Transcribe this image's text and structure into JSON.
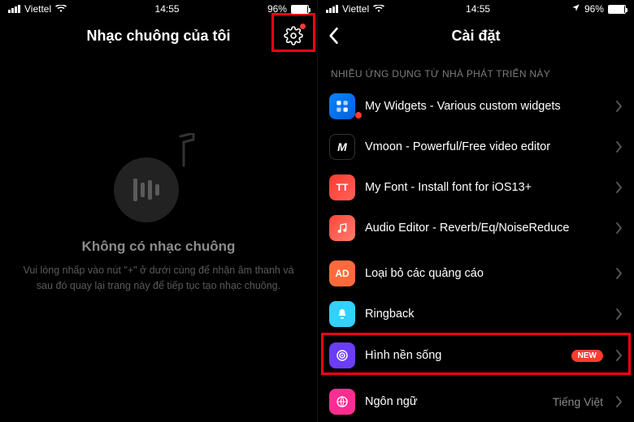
{
  "status": {
    "carrier": "Viettel",
    "time": "14:55",
    "battery_pct": "96%",
    "battery_level_pct": 96,
    "right_has_location": true
  },
  "left": {
    "title": "Nhạc chuông của tôi",
    "empty_title": "Không có nhạc chuông",
    "empty_sub": "Vui lòng nhấp vào nút \"+\" ở dưới cùng để nhận âm thanh và sau đó quay lại trang này để tiếp tục tạo nhạc chuông."
  },
  "right": {
    "title": "Cài đặt",
    "section_header": "NHIỀU ỨNG DỤNG TỪ NHÀ PHÁT TRIỂN NÀY",
    "rows_group1": [
      {
        "label": "My Widgets - Various custom widgets",
        "icon": "widgets"
      },
      {
        "label": "Vmoon - Powerful/Free video editor",
        "icon": "vmoon"
      },
      {
        "label": "My Font - Install font for iOS13+",
        "icon": "font"
      },
      {
        "label": "Audio Editor - Reverb/Eq/NoiseReduce",
        "icon": "audio"
      }
    ],
    "rows_group2": [
      {
        "label": "Loại bỏ các quảng cáo",
        "icon": "ad"
      },
      {
        "label": "Ringback",
        "icon": "ring"
      },
      {
        "label": "Hình nền sống",
        "icon": "wall",
        "badge": "NEW"
      }
    ],
    "rows_group3": [
      {
        "label": "Ngôn ngữ",
        "icon": "lang",
        "detail": "Tiếng Việt"
      }
    ]
  }
}
